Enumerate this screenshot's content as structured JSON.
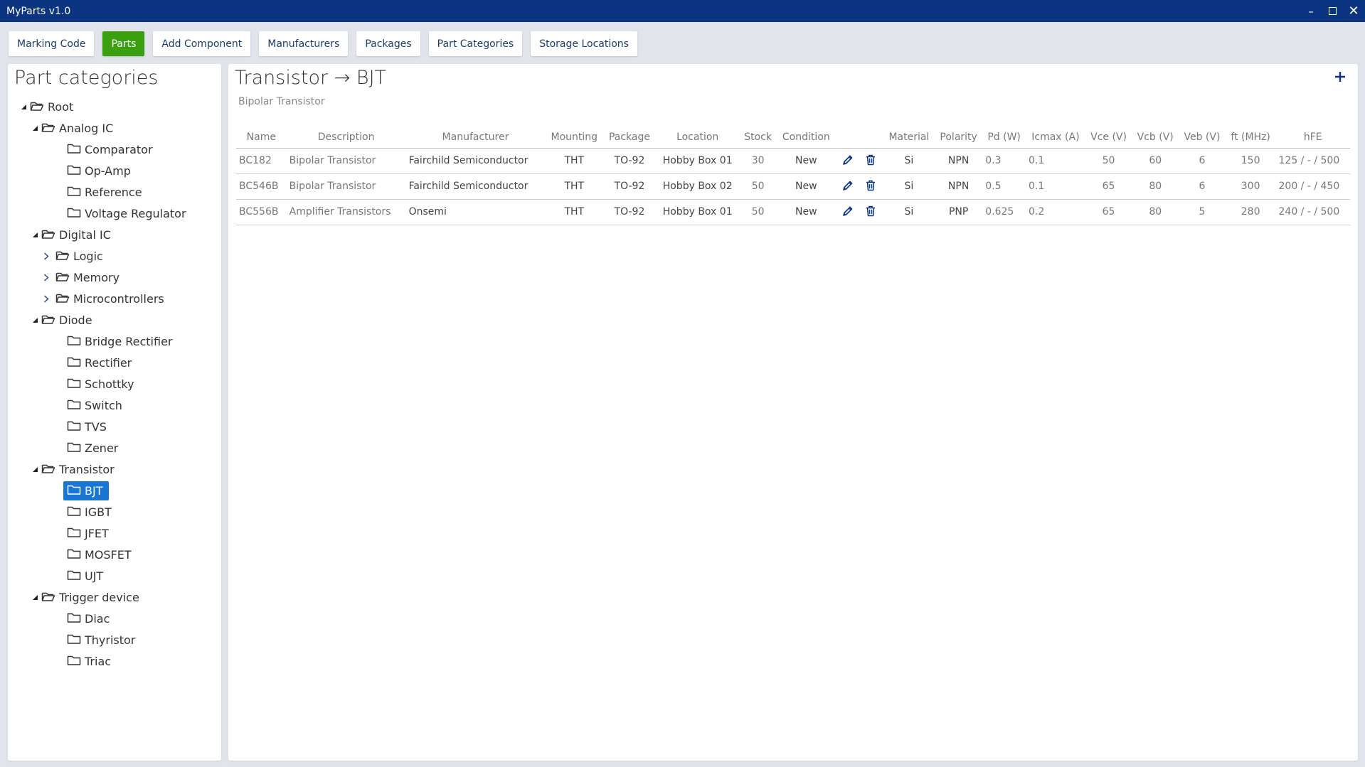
{
  "window": {
    "title": "MyParts v1.0",
    "minimize": "–",
    "close": "✕"
  },
  "tabs": [
    {
      "label": "Marking Code",
      "active": false
    },
    {
      "label": "Parts",
      "active": true
    },
    {
      "label": "Add Component",
      "active": false
    },
    {
      "label": "Manufacturers",
      "active": false
    },
    {
      "label": "Packages",
      "active": false
    },
    {
      "label": "Part Categories",
      "active": false
    },
    {
      "label": "Storage Locations",
      "active": false
    }
  ],
  "sidebar": {
    "heading": "Part categories",
    "tree": [
      {
        "label": "Root",
        "level": 0,
        "expander": "expanded",
        "icon": "folder-open-icon"
      },
      {
        "label": "Analog IC",
        "level": 1,
        "expander": "expanded",
        "icon": "folder-open-icon"
      },
      {
        "label": "Comparator",
        "level": 2,
        "expander": "none",
        "icon": "folder-icon"
      },
      {
        "label": "Op-Amp",
        "level": 2,
        "expander": "none",
        "icon": "folder-icon"
      },
      {
        "label": "Reference",
        "level": 2,
        "expander": "none",
        "icon": "folder-icon"
      },
      {
        "label": "Voltage Regulator",
        "level": 2,
        "expander": "none",
        "icon": "folder-icon"
      },
      {
        "label": "Digital IC",
        "level": 1,
        "expander": "expanded",
        "icon": "folder-open-icon"
      },
      {
        "label": "Logic",
        "level": 2,
        "expander": "collapsed",
        "icon": "folder-open-icon"
      },
      {
        "label": "Memory",
        "level": 2,
        "expander": "collapsed",
        "icon": "folder-open-icon"
      },
      {
        "label": "Microcontrollers",
        "level": 2,
        "expander": "collapsed",
        "icon": "folder-open-icon"
      },
      {
        "label": "Diode",
        "level": 1,
        "expander": "expanded",
        "icon": "folder-open-icon"
      },
      {
        "label": "Bridge Rectifier",
        "level": 2,
        "expander": "none",
        "icon": "folder-icon"
      },
      {
        "label": "Rectifier",
        "level": 2,
        "expander": "none",
        "icon": "folder-icon"
      },
      {
        "label": "Schottky",
        "level": 2,
        "expander": "none",
        "icon": "folder-icon"
      },
      {
        "label": "Switch",
        "level": 2,
        "expander": "none",
        "icon": "folder-icon"
      },
      {
        "label": "TVS",
        "level": 2,
        "expander": "none",
        "icon": "folder-icon"
      },
      {
        "label": "Zener",
        "level": 2,
        "expander": "none",
        "icon": "folder-icon"
      },
      {
        "label": "Transistor",
        "level": 1,
        "expander": "expanded",
        "icon": "folder-open-icon"
      },
      {
        "label": "BJT",
        "level": 2,
        "expander": "none",
        "icon": "folder-icon",
        "selected": true
      },
      {
        "label": "IGBT",
        "level": 2,
        "expander": "none",
        "icon": "folder-icon"
      },
      {
        "label": "JFET",
        "level": 2,
        "expander": "none",
        "icon": "folder-icon"
      },
      {
        "label": "MOSFET",
        "level": 2,
        "expander": "none",
        "icon": "folder-icon"
      },
      {
        "label": "UJT",
        "level": 2,
        "expander": "none",
        "icon": "folder-icon"
      },
      {
        "label": "Trigger device",
        "level": 1,
        "expander": "expanded",
        "icon": "folder-open-icon"
      },
      {
        "label": "Diac",
        "level": 2,
        "expander": "none",
        "icon": "folder-icon"
      },
      {
        "label": "Thyristor",
        "level": 2,
        "expander": "none",
        "icon": "folder-icon"
      },
      {
        "label": "Triac",
        "level": 2,
        "expander": "none",
        "icon": "folder-icon"
      }
    ]
  },
  "main": {
    "breadcrumb": "Transistor → BJT",
    "subtitle": "Bipolar Transistor",
    "add_icon": "plus-icon",
    "columns": [
      "Name",
      "Description",
      "Manufacturer",
      "Mounting",
      "Package",
      "Location",
      "Stock",
      "Condition",
      "",
      "Material",
      "Polarity",
      "Pd (W)",
      "Icmax (A)",
      "Vce (V)",
      "Vcb (V)",
      "Veb (V)",
      "ft (MHz)",
      "hFE"
    ],
    "rows": [
      {
        "name": "BC182",
        "description": "Bipolar Transistor",
        "manufacturer": "Fairchild Semiconductor",
        "mounting": "THT",
        "package": "TO-92",
        "location": "Hobby Box 01",
        "stock": "30",
        "condition": "New",
        "material": "Si",
        "polarity": "NPN",
        "pd": "0.3",
        "icmax": "0.1",
        "vce": "50",
        "vcb": "60",
        "veb": "6",
        "ft": "150",
        "hfe": "125 / - / 500"
      },
      {
        "name": "BC546B",
        "description": "Bipolar Transistor",
        "manufacturer": "Fairchild Semiconductor",
        "mounting": "THT",
        "package": "TO-92",
        "location": "Hobby Box 02",
        "stock": "50",
        "condition": "New",
        "material": "Si",
        "polarity": "NPN",
        "pd": "0.5",
        "icmax": "0.1",
        "vce": "65",
        "vcb": "80",
        "veb": "6",
        "ft": "300",
        "hfe": "200 / - / 450"
      },
      {
        "name": "BC556B",
        "description": "Amplifier Transistors",
        "manufacturer": "Onsemi",
        "mounting": "THT",
        "package": "TO-92",
        "location": "Hobby Box 01",
        "stock": "50",
        "condition": "New",
        "material": "Si",
        "polarity": "PNP",
        "pd": "0.625",
        "icmax": "0.2",
        "vce": "65",
        "vcb": "80",
        "veb": "5",
        "ft": "280",
        "hfe": "240 / - / 500"
      }
    ]
  },
  "colors": {
    "titlebar": "#0b3580",
    "active_tab": "#3aa00f",
    "selection": "#1976d2",
    "icon": "#0b3580"
  }
}
